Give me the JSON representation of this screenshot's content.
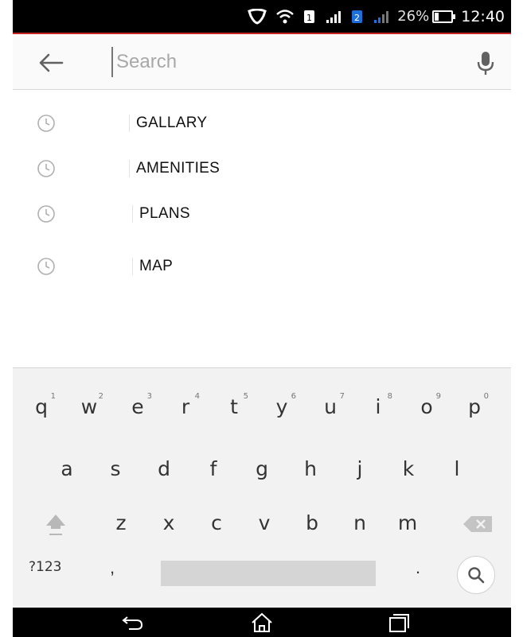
{
  "status_bar": {
    "battery_percent": "26%",
    "time": "12:40",
    "icons": [
      "shield-icon",
      "wifi-icon",
      "sim1-icon",
      "signal-icon",
      "sim2-icon",
      "signal-icon",
      "battery-icon"
    ],
    "sim1_label": "1",
    "sim2_label": "2",
    "battery_level": 0.26
  },
  "search": {
    "placeholder": "Search",
    "value": "",
    "back_icon": "arrow-left-icon",
    "mic_icon": "microphone-icon"
  },
  "suggestions": [
    {
      "label": "GALLARY",
      "icon": "history-clock-icon"
    },
    {
      "label": "AMENITIES",
      "icon": "history-clock-icon"
    },
    {
      "label": "PLANS",
      "icon": "history-clock-icon"
    },
    {
      "label": "MAP",
      "icon": "history-clock-icon"
    }
  ],
  "keyboard": {
    "row1": [
      {
        "key": "q",
        "hint": "1"
      },
      {
        "key": "w",
        "hint": "2"
      },
      {
        "key": "e",
        "hint": "3"
      },
      {
        "key": "r",
        "hint": "4"
      },
      {
        "key": "t",
        "hint": "5"
      },
      {
        "key": "y",
        "hint": "6"
      },
      {
        "key": "u",
        "hint": "7"
      },
      {
        "key": "i",
        "hint": "8"
      },
      {
        "key": "o",
        "hint": "9"
      },
      {
        "key": "p",
        "hint": "0"
      }
    ],
    "row2": [
      "a",
      "s",
      "d",
      "f",
      "g",
      "h",
      "j",
      "k",
      "l"
    ],
    "row3": [
      "z",
      "x",
      "c",
      "v",
      "b",
      "n",
      "m"
    ],
    "num_key": "?123",
    "comma": ",",
    "period": ".",
    "shift_icon": "shift-arrow-icon",
    "backspace_icon": "backspace-icon",
    "search_icon": "search-icon"
  },
  "nav_bar": {
    "icons": [
      "back-nav-icon",
      "home-icon",
      "recent-apps-icon"
    ]
  },
  "colors": {
    "status_bar_bg": "#000000",
    "accent_line": "#c62828",
    "search_bar_bg": "#fafafa",
    "keyboard_bg": "#f2f2f2",
    "icon_gray": "#9e9e9e"
  }
}
